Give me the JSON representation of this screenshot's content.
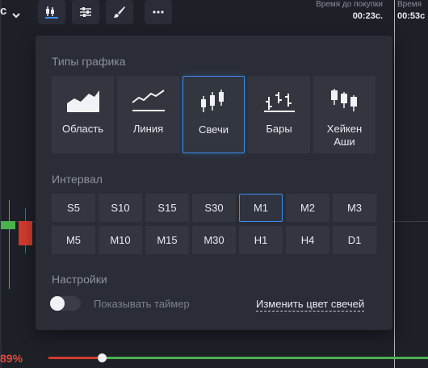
{
  "toolbar": {
    "asset_label": "c",
    "notification_badge": "",
    "buy_time_1": {
      "title": "Время до покупки",
      "value": "00:23с."
    },
    "buy_time_2": {
      "title": "Время",
      "value": "00:53с"
    }
  },
  "panel": {
    "chart_types_title": "Типы графика",
    "chart_types": [
      {
        "label": "Область",
        "icon": "area-chart-icon"
      },
      {
        "label": "Линия",
        "icon": "line-chart-icon"
      },
      {
        "label": "Свечи",
        "icon": "candles-icon",
        "selected": true
      },
      {
        "label": "Бары",
        "icon": "bars-icon"
      },
      {
        "label": "Хейкен Аши",
        "icon": "heikin-ashi-icon"
      }
    ],
    "interval_title": "Интервал",
    "intervals": [
      "S5",
      "S10",
      "S15",
      "S30",
      "M1",
      "M2",
      "M3",
      "M5",
      "M10",
      "M15",
      "M30",
      "H1",
      "H4",
      "D1"
    ],
    "selected_interval": "M1",
    "settings_title": "Настройки",
    "show_timer_label": "Показывать таймер",
    "show_timer_on": false,
    "change_candle_color_label": "Изменить цвет свечей"
  },
  "bottom": {
    "percent": "89%",
    "progress_fraction": 0.14
  },
  "colors": {
    "accent": "#3c8ff0",
    "bull": "#4caf50",
    "bear": "#d13b2e"
  }
}
